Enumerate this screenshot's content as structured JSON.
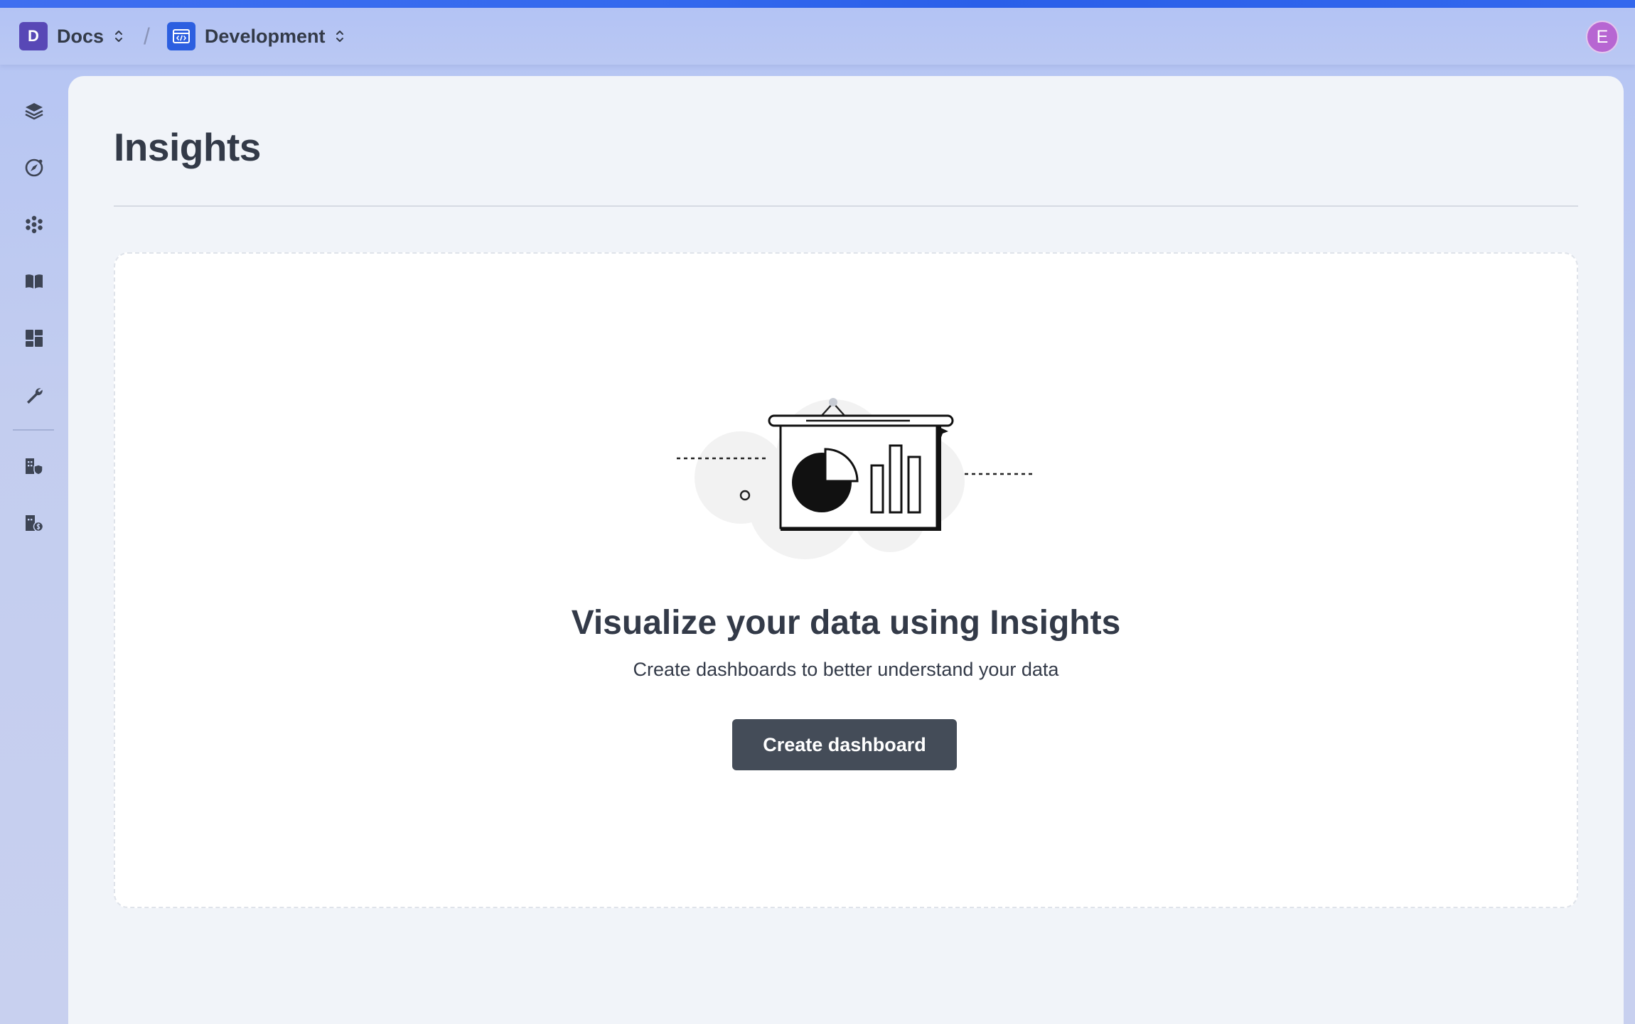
{
  "header": {
    "org": {
      "badge": "D",
      "label": "Docs"
    },
    "separator": "/",
    "environment": {
      "label": "Development"
    },
    "avatar": "E"
  },
  "sidebar": {
    "items": [
      {
        "icon": "layers-icon"
      },
      {
        "icon": "compass-icon"
      },
      {
        "icon": "integrations-icon"
      },
      {
        "icon": "book-icon"
      },
      {
        "icon": "dashboard-icon"
      },
      {
        "icon": "wrench-icon"
      },
      {
        "icon": "organization-shield-icon"
      },
      {
        "icon": "billing-icon"
      }
    ]
  },
  "main": {
    "title": "Insights",
    "empty_state": {
      "heading": "Visualize your data using Insights",
      "subtext": "Create dashboards to better understand your data",
      "button": "Create dashboard"
    }
  },
  "colors": {
    "top_strip": "#2a5fe9",
    "org_badge": "#5848b6",
    "env_badge": "#2c5fe0",
    "avatar": "#b766d2",
    "primary_button": "#444c58",
    "text": "#333a48"
  }
}
